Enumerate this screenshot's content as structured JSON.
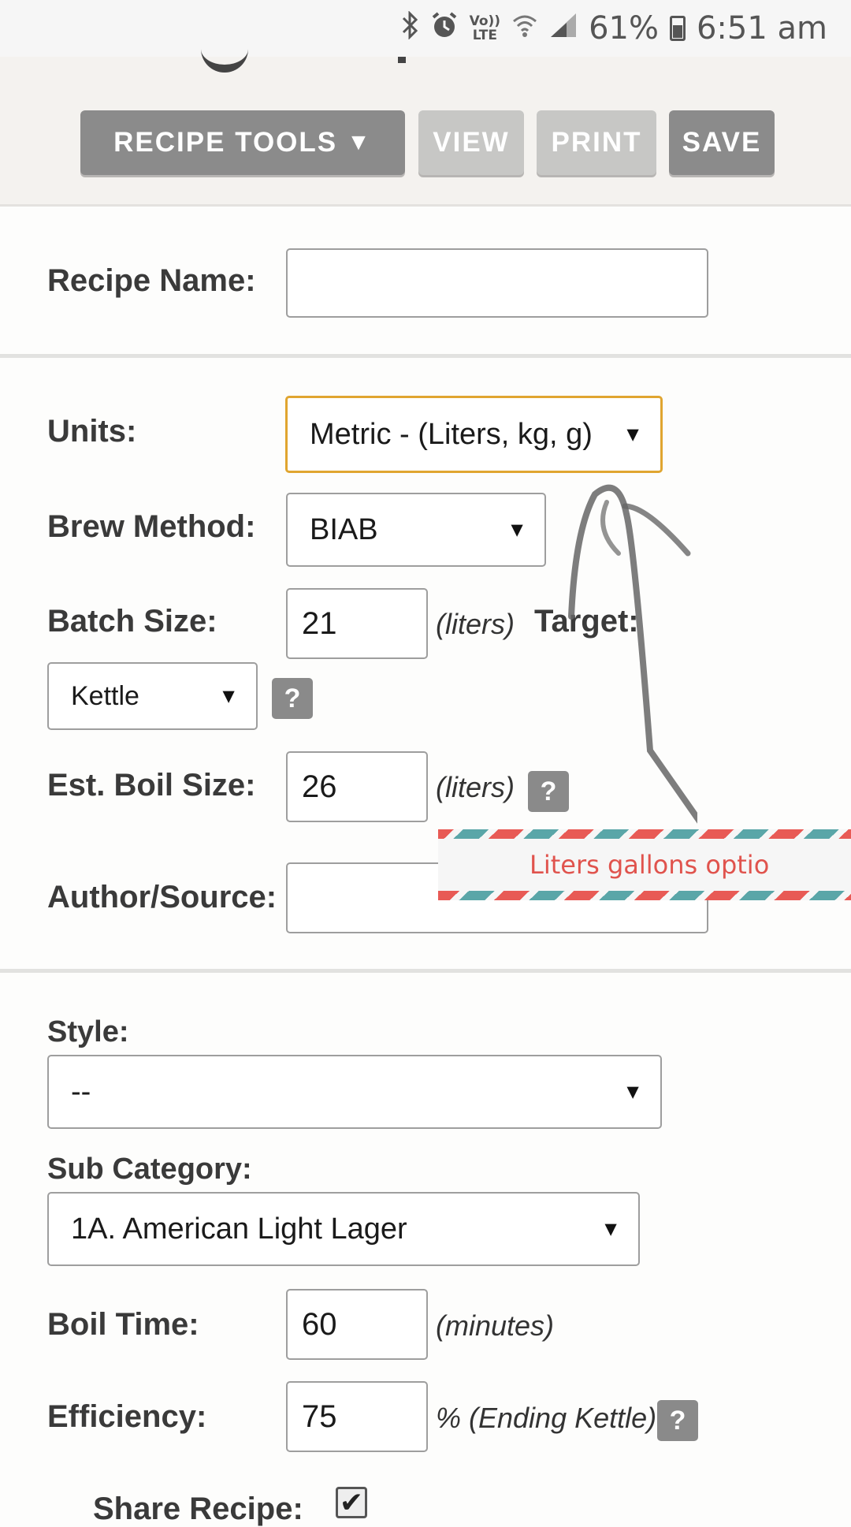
{
  "status_bar": {
    "icons": [
      "bluetooth-icon",
      "alarm-icon",
      "volte-icon",
      "wifi-icon",
      "signal-icon"
    ],
    "volte_text_top": "Vo))",
    "volte_text_bottom": "LTE",
    "battery": "61%",
    "time": "6:51 am"
  },
  "toolbar": {
    "recipe_tools": "RECIPE TOOLS",
    "recipe_tools_arrow": "▼",
    "view": "VIEW",
    "print": "PRINT",
    "save": "SAVE"
  },
  "form": {
    "recipe_name_label": "Recipe Name:",
    "recipe_name_value": "",
    "units_label": "Units:",
    "units_value": "Metric - (Liters, kg, g)",
    "brew_method_label": "Brew Method:",
    "brew_method_value": "BIAB",
    "batch_size_label": "Batch Size:",
    "batch_size_value": "21",
    "batch_size_unit": "(liters)",
    "target_label": "Target:",
    "target_value": "Kettle",
    "help": "?",
    "boil_size_label": "Est. Boil Size:",
    "boil_size_value": "26",
    "boil_size_unit": "(liters)",
    "author_label": "Author/Source:",
    "author_value": "",
    "style_label": "Style:",
    "style_value": "--",
    "sub_category_label": "Sub Category:",
    "sub_category_value": "1A. American Light Lager",
    "boil_time_label": "Boil Time:",
    "boil_time_value": "60",
    "boil_time_unit": "(minutes)",
    "efficiency_label": "Efficiency:",
    "efficiency_value": "75",
    "efficiency_unit": "% (Ending Kettle)",
    "share_label": "Share Recipe:",
    "share_checked": "✔"
  },
  "annotation": {
    "text": "Liters gallons optio",
    "colors": {
      "text": "#e0534d",
      "stripe_red": "#e85a55",
      "stripe_teal": "#5aa6a8"
    }
  },
  "colors": {
    "focus_border": "#e0a530",
    "button_dark": "#8b8b8b",
    "button_light": "#c7c7c5"
  }
}
